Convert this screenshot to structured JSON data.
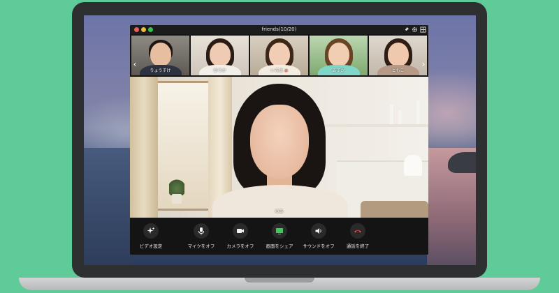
{
  "window": {
    "title": "friends(10/20)"
  },
  "participants": [
    {
      "name": "りょうすけ",
      "mic_muted": false
    },
    {
      "name": "ゆうか",
      "mic_muted": false
    },
    {
      "name": "いろは",
      "mic_muted": true
    },
    {
      "name": "あすか",
      "mic_muted": false
    },
    {
      "name": "ともこ",
      "mic_muted": false
    }
  ],
  "main_speaker": {
    "name": "のあ"
  },
  "controls": [
    {
      "label": "ビデオ設定",
      "icon": "sparkle-icon"
    },
    {
      "label": "マイクをオフ",
      "icon": "microphone-icon"
    },
    {
      "label": "カメラをオフ",
      "icon": "camera-icon"
    },
    {
      "label": "画面をシェア",
      "icon": "screen-share-icon",
      "color": "#3ecb55"
    },
    {
      "label": "サウンドをオフ",
      "icon": "speaker-icon"
    },
    {
      "label": "通話を終了",
      "icon": "end-call-icon",
      "color": "#f24a3c"
    }
  ],
  "colors": {
    "background": "#5fcb98",
    "accent_green": "#3ecb55",
    "end_call_red": "#f24a3c"
  }
}
